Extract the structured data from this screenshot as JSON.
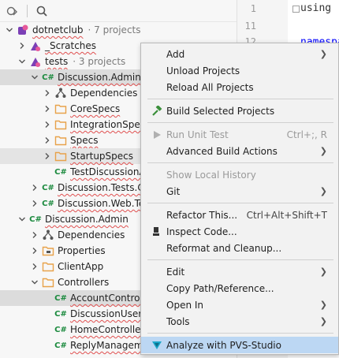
{
  "colors": {
    "accent": "#bcd7f3",
    "selection_row": "#dcdcdc",
    "folder": "#e8a24a",
    "csharp": "#1b8a3e",
    "error_squiggle": "#e05050"
  },
  "toolbar": {
    "icons": [
      "collapse-icon",
      "search-icon"
    ]
  },
  "tree": {
    "rows": [
      {
        "label": "dotnetclub",
        "meta": "· 7 projects",
        "icon": "solution-icon"
      },
      {
        "label": "_Scratches",
        "meta": "",
        "icon": "scratches-icon"
      },
      {
        "label": "tests",
        "meta": "· 3 projects",
        "icon": "solution-folder-icon"
      },
      {
        "label": "Discussion.Admin.T",
        "meta": "",
        "icon": "csharp-project-icon"
      },
      {
        "label": "Dependencies",
        "meta": "",
        "icon": "dependencies-icon"
      },
      {
        "label": "CoreSpecs",
        "meta": "",
        "icon": "folder-icon"
      },
      {
        "label": "IntegrationSpec",
        "meta": "",
        "icon": "folder-icon"
      },
      {
        "label": "Specs",
        "meta": "",
        "icon": "folder-icon"
      },
      {
        "label": "StartupSpecs",
        "meta": "",
        "icon": "folder-icon"
      },
      {
        "label": "TestDiscussionA",
        "meta": "",
        "icon": "csharp-file-icon"
      },
      {
        "label": "Discussion.Tests.Co",
        "meta": "",
        "icon": "csharp-project-icon"
      },
      {
        "label": "Discussion.Web.Tes",
        "meta": "",
        "icon": "csharp-project-icon"
      },
      {
        "label": "Discussion.Admin",
        "meta": "",
        "icon": "csharp-project-icon"
      },
      {
        "label": "Dependencies",
        "meta": "",
        "icon": "dependencies-icon"
      },
      {
        "label": "Properties",
        "meta": "",
        "icon": "properties-icon"
      },
      {
        "label": "ClientApp",
        "meta": "",
        "icon": "folder-icon"
      },
      {
        "label": "Controllers",
        "meta": "",
        "icon": "folder-icon"
      },
      {
        "label": "AccountControl",
        "meta": "",
        "icon": "csharp-file-icon"
      },
      {
        "label": "DiscussionUserM",
        "meta": "",
        "icon": "csharp-file-icon"
      },
      {
        "label": "HomeController",
        "meta": "",
        "icon": "csharp-file-icon"
      },
      {
        "label": "ReplyManagem",
        "meta": "",
        "icon": "csharp-file-icon"
      }
    ]
  },
  "editor": {
    "line_numbers": [
      "1",
      "11",
      "12"
    ],
    "code_lines": [
      "using",
      "namespa"
    ]
  },
  "context_menu": {
    "items": [
      {
        "label": "Add",
        "shortcut": "",
        "submenu": true
      },
      {
        "label": "Unload Projects",
        "shortcut": ""
      },
      {
        "label": "Reload All Projects",
        "shortcut": ""
      },
      {
        "label": "Build Selected Projects",
        "shortcut": "",
        "icon": "hammer-icon"
      },
      {
        "label": "Run Unit Test",
        "shortcut": "Ctrl+;, R",
        "disabled": true,
        "icon": "run-icon"
      },
      {
        "label": "Advanced Build Actions",
        "shortcut": "",
        "submenu": true
      },
      {
        "label": "Show Local History",
        "shortcut": "",
        "disabled": true
      },
      {
        "label": "Git",
        "shortcut": "",
        "submenu": true
      },
      {
        "label": "Refactor This...",
        "shortcut": "Ctrl+Alt+Shift+T"
      },
      {
        "label": "Inspect Code...",
        "shortcut": "",
        "icon": "inspect-icon"
      },
      {
        "label": "Reformat and Cleanup...",
        "shortcut": ""
      },
      {
        "label": "Edit",
        "shortcut": "",
        "submenu": true
      },
      {
        "label": "Copy Path/Reference...",
        "shortcut": ""
      },
      {
        "label": "Open In",
        "shortcut": "",
        "submenu": true
      },
      {
        "label": "Tools",
        "shortcut": "",
        "submenu": true
      },
      {
        "label": "Analyze with PVS-Studio",
        "shortcut": "",
        "icon": "pvs-studio-icon",
        "highlighted": true
      }
    ]
  }
}
